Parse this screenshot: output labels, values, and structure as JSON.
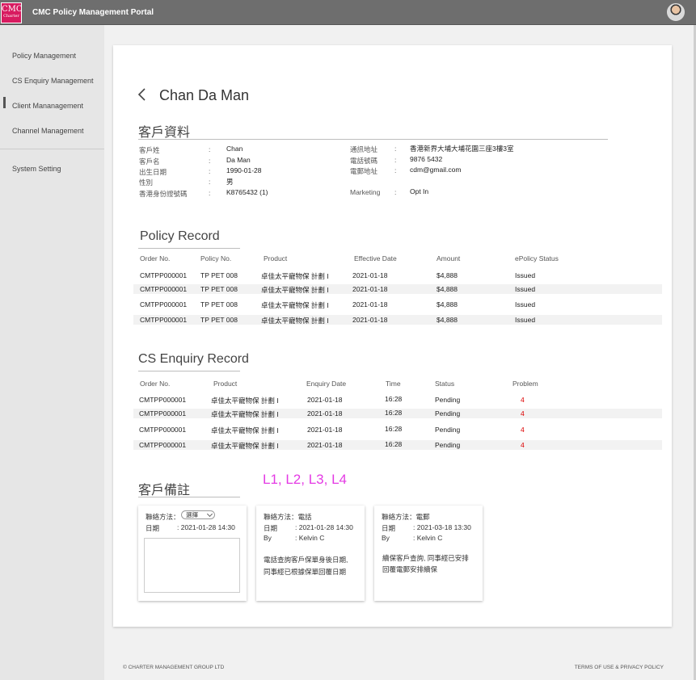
{
  "header": {
    "logo_text": "CMC",
    "logo_sub": "Charter",
    "title": "CMC Policy Management Portal",
    "avatar_icon": "user-avatar"
  },
  "sidebar": {
    "items": [
      {
        "label": "Policy Management"
      },
      {
        "label": "CS Enquiry Management"
      },
      {
        "label": "Client Mananagement"
      },
      {
        "label": "Channel Management"
      },
      {
        "label": "System Setting"
      }
    ]
  },
  "client": {
    "name": "Chan Da Man"
  },
  "client_info": {
    "title": "客戶資料",
    "left": [
      {
        "label": "客戶姓",
        "value": "Chan"
      },
      {
        "label": "客戶名",
        "value": "Da Man"
      },
      {
        "label": "出生日期",
        "value": "1990-01-28"
      },
      {
        "label": "性別",
        "value": "男"
      },
      {
        "label": "香港身份證號碼",
        "value": "K8765432 (1)"
      }
    ],
    "right": [
      {
        "label": "通訊地址",
        "value": "香港新界大埔大埔花園三座3樓3室"
      },
      {
        "label": "電話號碼",
        "value": "9876 5432"
      },
      {
        "label": "電郵地址",
        "value": "cdm@gmail.com"
      },
      {
        "label": "Marketing",
        "value": "Opt In"
      }
    ],
    "colon": ":"
  },
  "policy_record": {
    "title": "Policy Record",
    "headers": [
      "Order No.",
      "Policy No.",
      "Product",
      "Effective Date",
      "Amount",
      "ePolicy Status"
    ],
    "rows": [
      [
        "CMTPP000001",
        "TP PET 008",
        "卓佳太平寵物保 計劃 I",
        "2021-01-18",
        "$4,888",
        "Issued"
      ],
      [
        "CMTPP000001",
        "TP PET 008",
        "卓佳太平寵物保 計劃 I",
        "2021-01-18",
        "$4,888",
        "Issued"
      ],
      [
        "CMTPP000001",
        "TP PET 008",
        "卓佳太平寵物保 計劃 I",
        "2021-01-18",
        "$4,888",
        "Issued"
      ],
      [
        "CMTPP000001",
        "TP PET 008",
        "卓佳太平寵物保 計劃 I",
        "2021-01-18",
        "$4,888",
        "Issued"
      ]
    ]
  },
  "cs_enquiry": {
    "title": "CS Enquiry Record",
    "headers": [
      "Order No.",
      "Product",
      "Enquiry Date",
      "Time",
      "Status",
      "Problem"
    ],
    "rows": [
      [
        "CMTPP000001",
        "卓佳太平寵物保 計劃 I",
        "2021-01-18",
        "16:28",
        "Pending",
        "4"
      ],
      [
        "CMTPP000001",
        "卓佳太平寵物保 計劃 I",
        "2021-01-18",
        "16:28",
        "Pending",
        "4"
      ],
      [
        "CMTPP000001",
        "卓佳太平寵物保 計劃 I",
        "2021-01-18",
        "16:28",
        "Pending",
        "4"
      ],
      [
        "CMTPP000001",
        "卓佳太平寵物保 計劃 I",
        "2021-01-18",
        "16:28",
        "Pending",
        "4"
      ]
    ]
  },
  "remarks": {
    "title": "客戶備註",
    "annotation": "L1, L2, L3, L4",
    "new_note": {
      "method_label": "聯絡方法：",
      "select_value": "選擇",
      "date_label": "日期",
      "date_value": ": 2021-01-28 14:30"
    },
    "notes": [
      {
        "method": "聯絡方法：電話",
        "date_label": "日期",
        "date_value": ": 2021-01-28 14:30",
        "by_label": "By",
        "by_value": ":  Kelvin C",
        "text1": "電話查詢客戶保單身後日期,",
        "text2": "同事經已根據保單回覆日期"
      },
      {
        "method": "聯絡方法：電郵",
        "date_label": "日期",
        "date_value": ": 2021-03-18 13:30",
        "by_label": "By",
        "by_value": ":  Kelvin C",
        "text1": "續保客戶查詢, 同事經已安排",
        "text2": "回覆電郵安排續保"
      }
    ]
  },
  "footer": {
    "copyright": "© CHARTER MANAGEMENT GROUP LTD",
    "terms": "TERMS OF USE & PRIVACY POLICY"
  }
}
